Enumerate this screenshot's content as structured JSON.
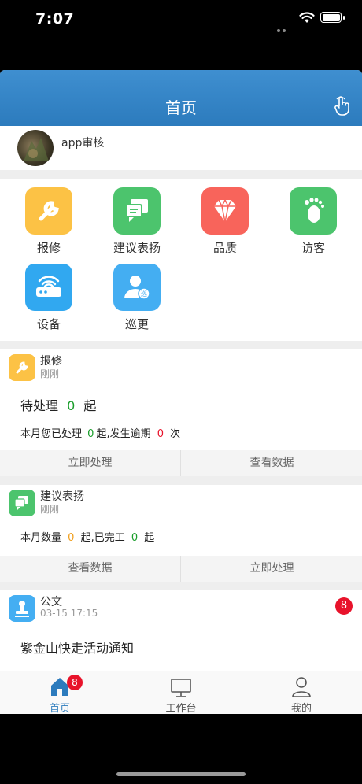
{
  "status": {
    "time": "7:07"
  },
  "nav": {
    "title": "首页",
    "right_icon": "hand-pointer-icon"
  },
  "user": {
    "name": "app审核"
  },
  "grid": [
    {
      "label": "报修",
      "color": "#fcc245",
      "icon": "wrench-icon"
    },
    {
      "label": "建议表扬",
      "color": "#4cc46d",
      "icon": "chat-icon"
    },
    {
      "label": "品质",
      "color": "#f8645b",
      "icon": "diamond-icon"
    },
    {
      "label": "访客",
      "color": "#4cc46d",
      "icon": "footprint-icon"
    },
    {
      "label": "设备",
      "color": "#31a8f0",
      "icon": "router-icon"
    },
    {
      "label": "巡更",
      "color": "#44aef2",
      "icon": "patrol-person-icon"
    }
  ],
  "cards": {
    "repair": {
      "title": "报修",
      "time": "刚刚",
      "pending_label": "待处理",
      "pending_count": "0",
      "pending_unit": "起",
      "stat_prefix": "本月您已处理",
      "handled": "0",
      "stat_mid": "起,发生逾期",
      "overdue": "0",
      "stat_suffix": "次",
      "actions": [
        "立即处理",
        "查看数据"
      ]
    },
    "suggest": {
      "title": "建议表扬",
      "time": "刚刚",
      "stat_prefix": "本月数量",
      "count": "0",
      "stat_mid": "起,已完工",
      "done": "0",
      "stat_suffix": "起",
      "actions": [
        "查看数据",
        "立即处理"
      ]
    },
    "doc": {
      "title": "公文",
      "time": "03-15 17:15",
      "badge": "8",
      "headline": "紫金山快走活动通知"
    }
  },
  "tabbar": {
    "tabs": [
      {
        "label": "首页",
        "badge": "8"
      },
      {
        "label": "工作台"
      },
      {
        "label": "我的"
      }
    ],
    "active_color": "#2c7bbd",
    "inactive_color": "#555555"
  }
}
